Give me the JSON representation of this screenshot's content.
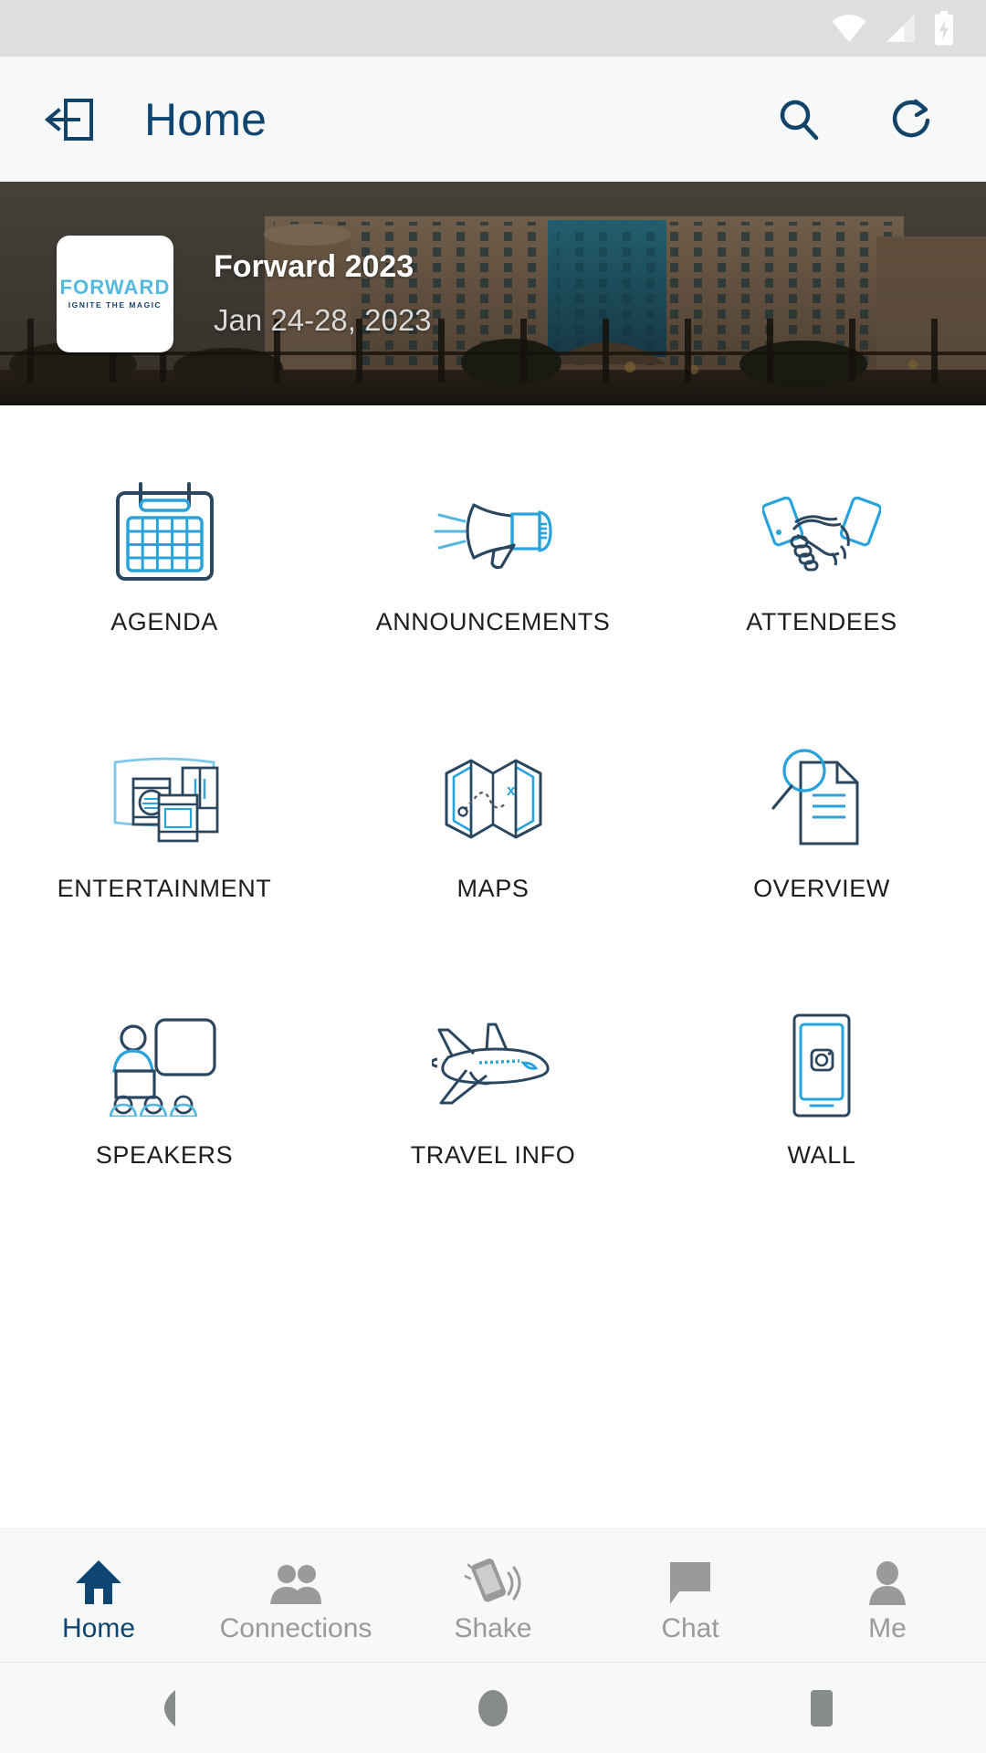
{
  "status_bar": {
    "icons": [
      "wifi-icon",
      "cellular-signal-icon",
      "battery-charging-icon"
    ]
  },
  "app_bar": {
    "exit_icon": "exit-door-icon",
    "title": "Home",
    "search_icon": "search-icon",
    "refresh_icon": "refresh-icon"
  },
  "banner": {
    "logo": {
      "word": "FORWARD",
      "tagline": "IGNITE THE MAGIC"
    },
    "title": "Forward 2023",
    "date": "Jan 24-28, 2023"
  },
  "grid": {
    "tiles": [
      {
        "label": "AGENDA",
        "icon": "calendar-icon"
      },
      {
        "label": "ANNOUNCEMENTS",
        "icon": "megaphone-icon"
      },
      {
        "label": "ATTENDEES",
        "icon": "handshake-icon"
      },
      {
        "label": "ENTERTAINMENT",
        "icon": "appliances-icon"
      },
      {
        "label": "MAPS",
        "icon": "folded-map-icon"
      },
      {
        "label": "OVERVIEW",
        "icon": "document-search-icon"
      },
      {
        "label": "SPEAKERS",
        "icon": "presenter-audience-icon"
      },
      {
        "label": "TRAVEL INFO",
        "icon": "airplane-icon"
      },
      {
        "label": "WALL",
        "icon": "phone-photo-icon"
      }
    ]
  },
  "bottom_nav": {
    "items": [
      {
        "label": "Home",
        "icon": "home-icon",
        "active": true
      },
      {
        "label": "Connections",
        "icon": "people-icon",
        "active": false
      },
      {
        "label": "Shake",
        "icon": "shake-phone-icon",
        "active": false
      },
      {
        "label": "Chat",
        "icon": "chat-bubble-icon",
        "active": false
      },
      {
        "label": "Me",
        "icon": "person-icon",
        "active": false
      }
    ]
  },
  "android_nav": {
    "back": "back-triangle-icon",
    "home": "home-circle-icon",
    "recents": "recents-square-icon"
  },
  "colors": {
    "brand_navy": "#0f4671",
    "brand_blue": "#29a3dc",
    "logo_blue": "#54b9de",
    "icon_dark": "#2b4760",
    "nav_inactive": "#9a9a9a",
    "status_bar_bg": "#dedede",
    "chrome_bg": "#f7f8f8"
  }
}
